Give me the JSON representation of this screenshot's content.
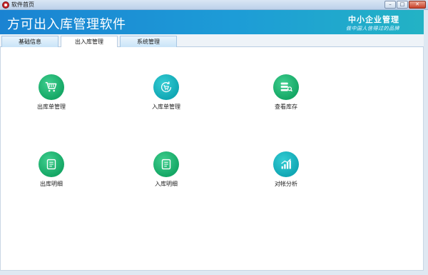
{
  "window": {
    "title": "软件首页",
    "controls": {
      "minimize": "–",
      "maximize": "□",
      "close": "✕"
    }
  },
  "banner": {
    "app_name": "方可出入库管理软件",
    "slogan_main": "中小企业管理",
    "slogan_sub": "做中国人信得过的品牌"
  },
  "tabs": [
    {
      "label": "基础信息",
      "active": false
    },
    {
      "label": "出入库管理",
      "active": true
    },
    {
      "label": "系统管理",
      "active": false
    }
  ],
  "tiles": [
    {
      "label": "出库单管理",
      "icon": "shopping-cart-icon",
      "color": "#19ad6c"
    },
    {
      "label": "入库单管理",
      "icon": "refresh-cart-icon",
      "color": "#14aab6"
    },
    {
      "label": "查看库存",
      "icon": "stack-list-icon",
      "color": "#19ad6c"
    },
    {
      "label": "出库明细",
      "icon": "detail-document-icon",
      "color": "#19ad6c"
    },
    {
      "label": "入库明细",
      "icon": "detail-document-icon",
      "color": "#19ad6c"
    },
    {
      "label": "对帐分析",
      "icon": "bar-chart-icon",
      "color": "#14aab6"
    }
  ]
}
